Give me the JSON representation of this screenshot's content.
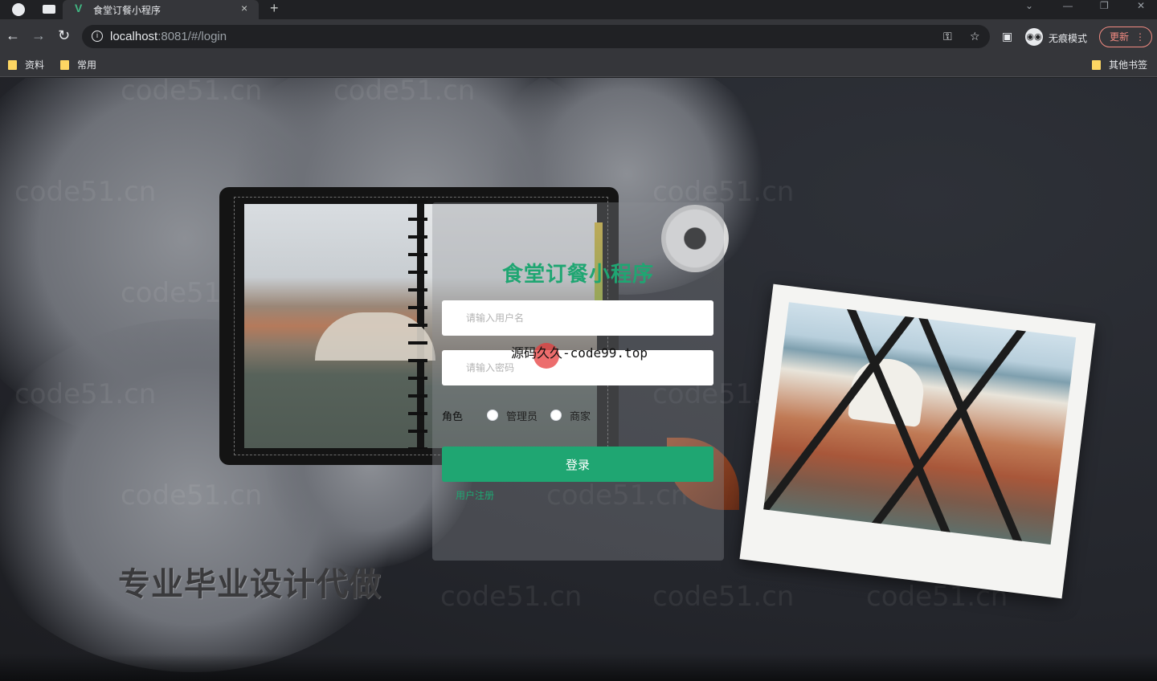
{
  "browser": {
    "tab_title": "食堂订餐小程序",
    "new_tab": "+",
    "tab_close": "×",
    "url_host": "localhost",
    "url_rest": ":8081/#/login",
    "incognito_label": "无痕模式",
    "update_label": "更新",
    "bookmarks": [
      "资料",
      "常用"
    ],
    "other_bookmarks": "其他书签"
  },
  "login": {
    "title": "食堂订餐小程序",
    "username_placeholder": "请输入用户名",
    "password_placeholder": "请输入密码",
    "role_label": "角色",
    "roles": [
      "管理员",
      "商家"
    ],
    "submit_label": "登录",
    "register_link": "用户注册"
  },
  "overlay": {
    "source_text": "源码久久-code99.top",
    "slogan": "专业毕业设计代做",
    "watermark": "code51.cn"
  },
  "colors": {
    "accent": "#1fa672"
  }
}
